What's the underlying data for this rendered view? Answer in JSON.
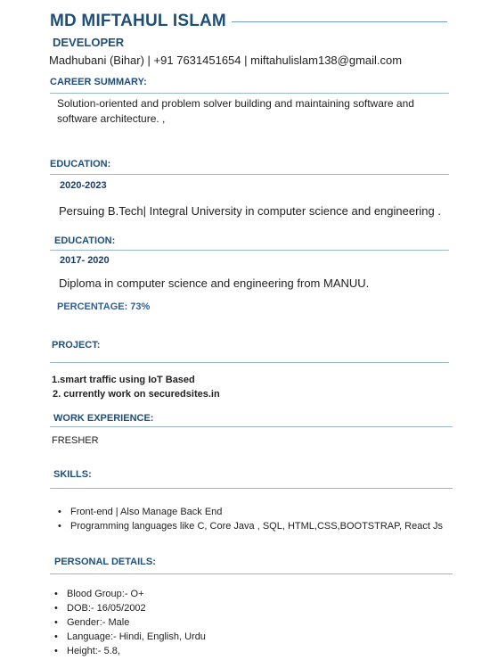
{
  "header": {
    "name": "MD MIFTAHUL ISLAM",
    "role": "DEVELOPER",
    "contact": "Madhubani (Bihar) | +91 7631451654 |  miftahulislam138@gmail.com"
  },
  "career": {
    "title": "CAREER SUMMARY:",
    "text": "Solution-oriented and problem solver  building and maintaining software and software architecture. ,"
  },
  "education_1": {
    "title": "EDUCATION:",
    "years": "2020-2023",
    "text": "Persuing B.Tech| Integral University in computer science and   engineering ."
  },
  "education_2": {
    "title": "EDUCATION:",
    "years": "2017- 2020",
    "text": "Diploma in computer science and engineering from MANUU.",
    "percentage": "PERCENTAGE: 73%"
  },
  "project": {
    "title": "PROJECT:",
    "items": [
      "1.smart traffic using IoT Based",
      "2. currently work on securedsites.in"
    ]
  },
  "work": {
    "title": "WORK EXPERIENCE:",
    "text": "FRESHER"
  },
  "skills": {
    "title": "SKILLS:",
    "items": [
      "Front-end | Also Manage Back End",
      "Programming languages like C, Core Java , SQL, HTML,CSS,BOOTSTRAP,  React Js"
    ]
  },
  "personal": {
    "title": "PERSONAL DETAILS:",
    "items": [
      "Blood Group:- O+",
      "DOB:- 16/05/2002",
      "Gender:- Male",
      "Language:- Hindi, English, Urdu",
      "Height:- 5.8,"
    ]
  },
  "glyphs": {
    "bullet": "•"
  },
  "colors": {
    "heading": "#1f4e79",
    "rule": "#9ab5d6"
  }
}
